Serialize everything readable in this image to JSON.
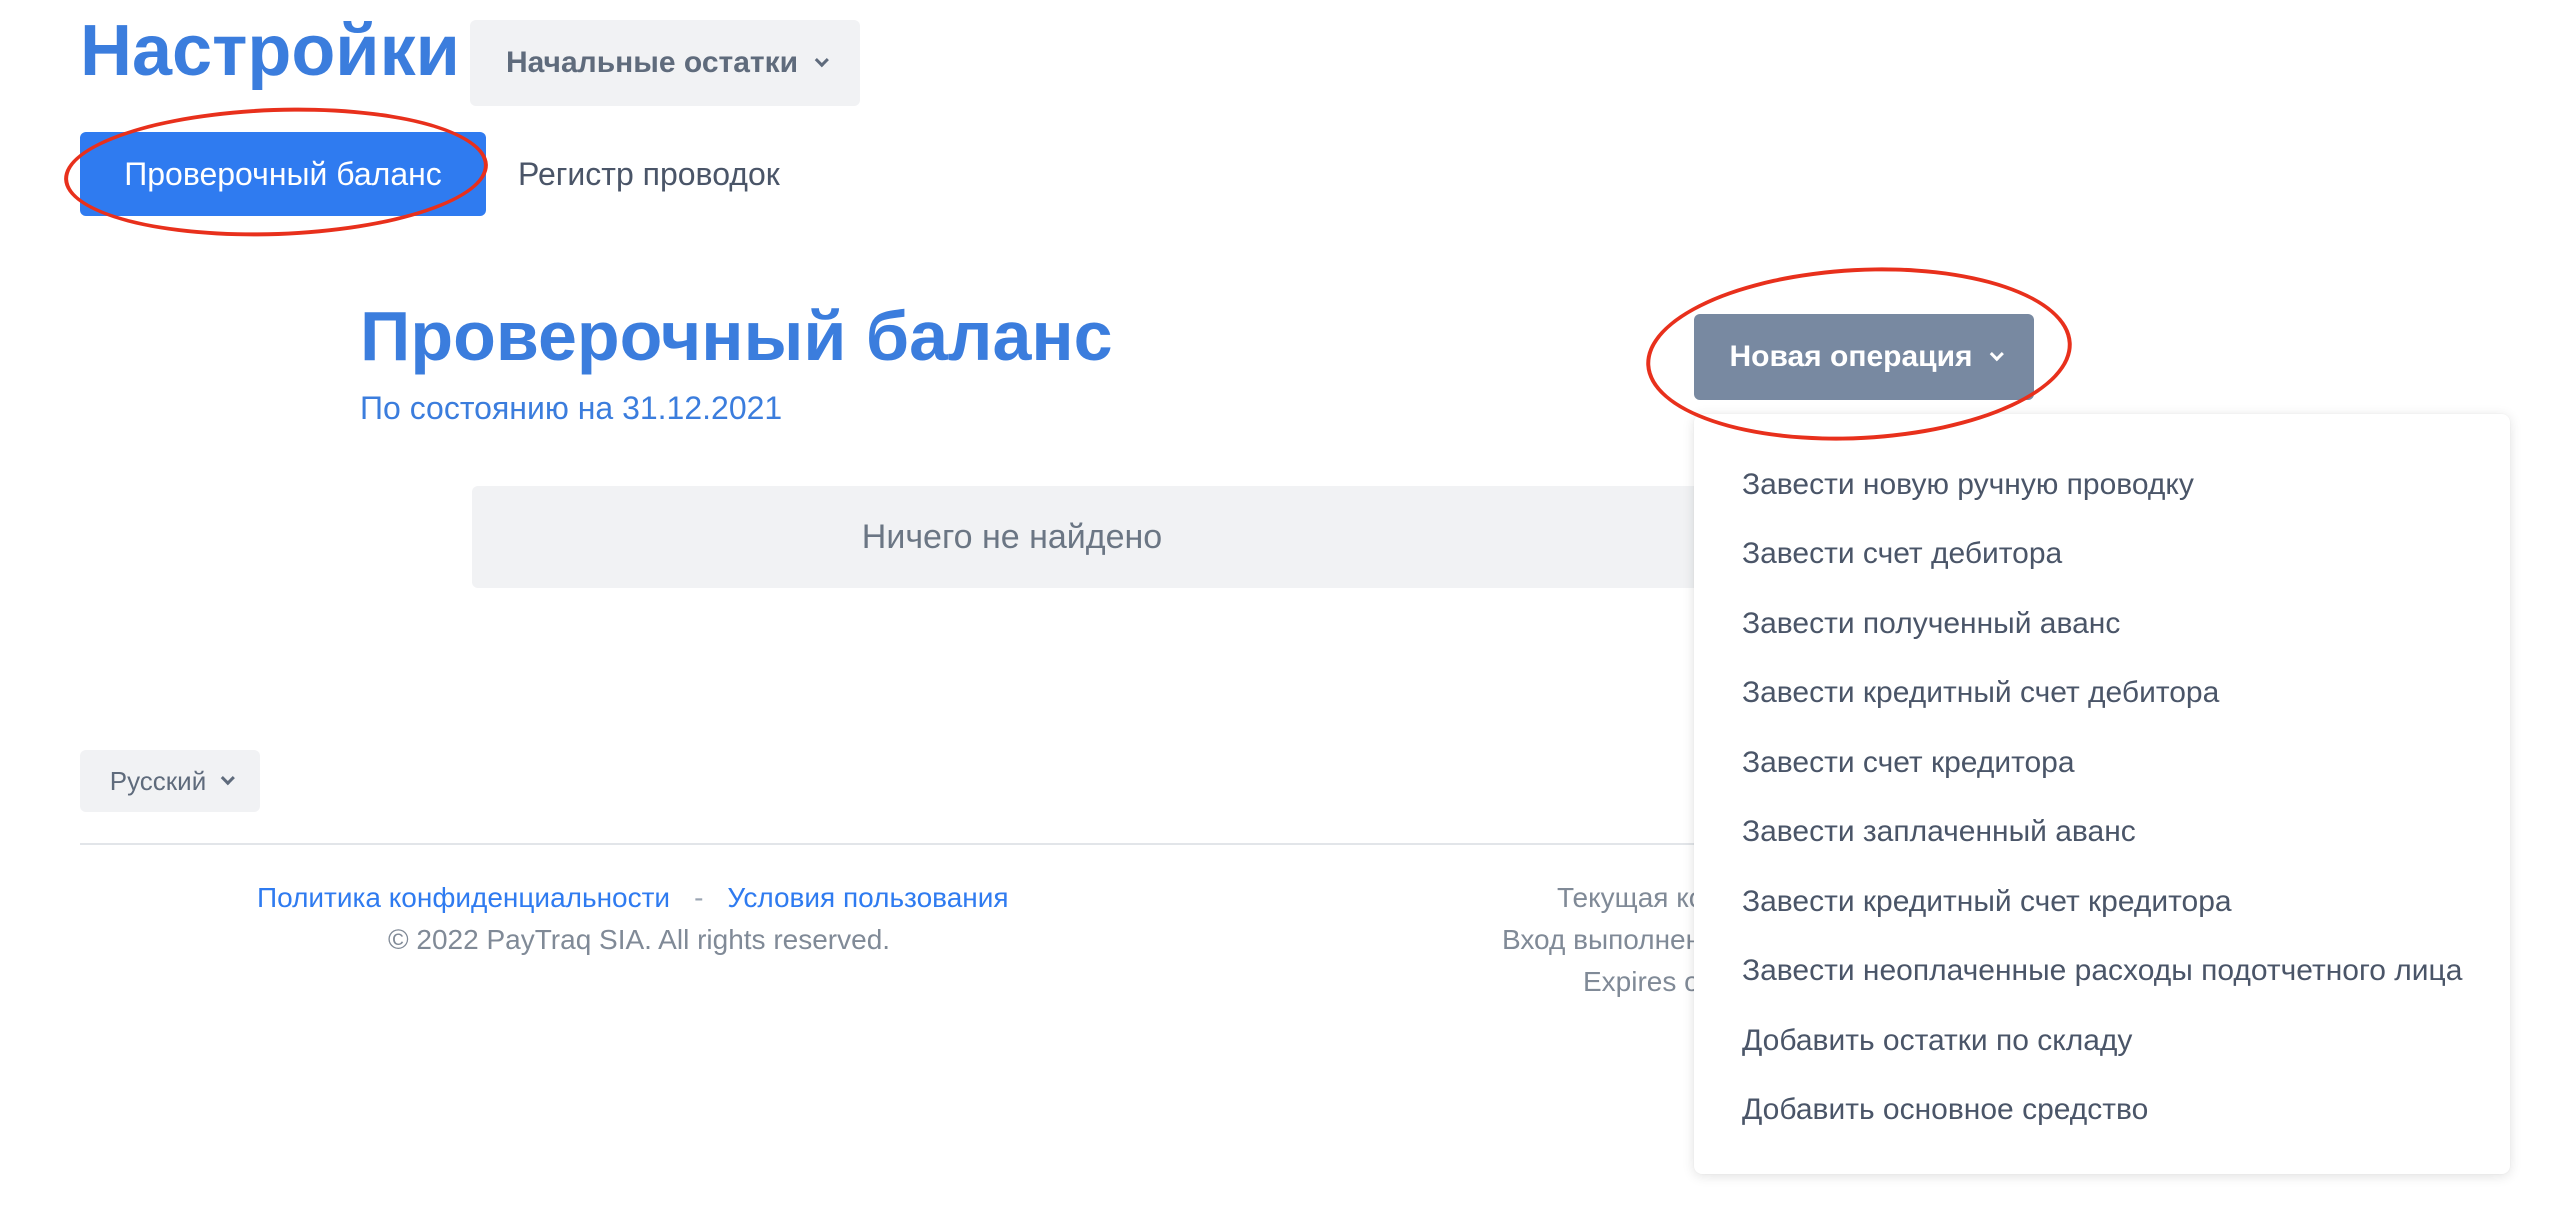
{
  "header": {
    "title": "Настройки",
    "settings_dropdown_label": "Начальные остатки"
  },
  "tabs": [
    {
      "label": "Проверочный баланс",
      "active": true
    },
    {
      "label": "Регистр проводок",
      "active": false
    }
  ],
  "main": {
    "title": "Проверочный баланс",
    "subtitle": "По состоянию на 31.12.2021",
    "empty_text": "Ничего не найдено",
    "new_operation_label": "Новая операция"
  },
  "new_operation_menu": {
    "items": [
      "Завести новую ручную проводку",
      "Завести счет дебитора",
      "Завести полученный аванс",
      "Завести кредитный счет дебитора",
      "Завести счет кредитора",
      "Завести заплаченный аванс",
      "Завести кредитный счет кредитора",
      "Завести неоплаченные расходы подотчетного лица",
      "Добавить остатки по складу",
      "Добавить основное средство"
    ]
  },
  "footer": {
    "language": "Русский",
    "privacy_link": "Политика конфиденциальности",
    "separator": "-",
    "terms_link": "Условия пользования",
    "copyright": "© 2022 PayTraq SIA. All rights reserved.",
    "right_line_1": "Текущая ко",
    "right_line_2": "Вход выполнен",
    "right_line_3": "Expires o"
  },
  "colors": {
    "accent": "#2f7bf0",
    "heading": "#3b7ddd",
    "button_gray": "#7889a1",
    "annotation": "#e8301c"
  }
}
